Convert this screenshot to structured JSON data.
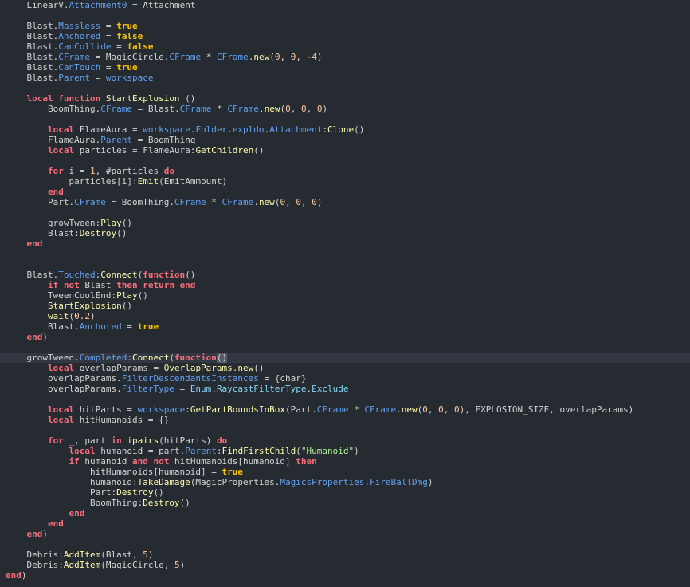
{
  "colors": {
    "background": "#262a31",
    "current_line": "#333741",
    "keyword": "#f86d7c",
    "boolean": "#ffc600",
    "property": "#61a1f1",
    "method": "#fdfbac",
    "number": "#ffc99e",
    "string": "#adf195",
    "enum": "#84d6f7",
    "identifier": "#d4d4d4"
  },
  "editor": {
    "highlighted_line": 34,
    "lines": [
      [
        [
          "    LinearV.",
          "id"
        ],
        [
          "Attachment0",
          "prop"
        ],
        [
          " = Attachment",
          "id"
        ]
      ],
      [],
      [
        [
          "    Blast.",
          "id"
        ],
        [
          "Massless",
          "prop"
        ],
        [
          " = ",
          "id"
        ],
        [
          "true",
          "bool"
        ]
      ],
      [
        [
          "    Blast.",
          "id"
        ],
        [
          "Anchored",
          "prop"
        ],
        [
          " = ",
          "id"
        ],
        [
          "false",
          "bool"
        ]
      ],
      [
        [
          "    Blast.",
          "id"
        ],
        [
          "CanCollide",
          "prop"
        ],
        [
          " = ",
          "id"
        ],
        [
          "false",
          "bool"
        ]
      ],
      [
        [
          "    Blast.",
          "id"
        ],
        [
          "CFrame",
          "prop"
        ],
        [
          " = MagicCircle.",
          "id"
        ],
        [
          "CFrame",
          "prop"
        ],
        [
          " * ",
          "id"
        ],
        [
          "CFrame",
          "prop"
        ],
        [
          ".",
          "id"
        ],
        [
          "new",
          "call"
        ],
        [
          "(",
          "id"
        ],
        [
          "0",
          "num"
        ],
        [
          ", ",
          "id"
        ],
        [
          "0",
          "num"
        ],
        [
          ", -",
          "id"
        ],
        [
          "4",
          "num"
        ],
        [
          ")",
          "id"
        ]
      ],
      [
        [
          "    Blast.",
          "id"
        ],
        [
          "CanTouch",
          "prop"
        ],
        [
          " = ",
          "id"
        ],
        [
          "true",
          "bool"
        ]
      ],
      [
        [
          "    Blast.",
          "id"
        ],
        [
          "Parent",
          "prop"
        ],
        [
          " = ",
          "id"
        ],
        [
          "workspace",
          "prop"
        ]
      ],
      [],
      [
        [
          "    ",
          "id"
        ],
        [
          "local function",
          "kw"
        ],
        [
          " ",
          "id"
        ],
        [
          "StartExplosion",
          "call"
        ],
        [
          " ()",
          "id"
        ]
      ],
      [
        [
          "        BoomThing.",
          "id"
        ],
        [
          "CFrame",
          "prop"
        ],
        [
          " = Blast.",
          "id"
        ],
        [
          "CFrame",
          "prop"
        ],
        [
          " * ",
          "id"
        ],
        [
          "CFrame",
          "prop"
        ],
        [
          ".",
          "id"
        ],
        [
          "new",
          "call"
        ],
        [
          "(",
          "id"
        ],
        [
          "0",
          "num"
        ],
        [
          ", ",
          "id"
        ],
        [
          "0",
          "num"
        ],
        [
          ", ",
          "id"
        ],
        [
          "0",
          "num"
        ],
        [
          ")",
          "id"
        ]
      ],
      [],
      [
        [
          "        ",
          "id"
        ],
        [
          "local",
          "kw"
        ],
        [
          " FlameAura = ",
          "id"
        ],
        [
          "workspace",
          "prop"
        ],
        [
          ".",
          "id"
        ],
        [
          "Folder",
          "prop"
        ],
        [
          ".",
          "id"
        ],
        [
          "expldo",
          "prop"
        ],
        [
          ".",
          "id"
        ],
        [
          "Attachment",
          "prop"
        ],
        [
          ":",
          "id"
        ],
        [
          "Clone",
          "call"
        ],
        [
          "()",
          "id"
        ]
      ],
      [
        [
          "        FlameAura.",
          "id"
        ],
        [
          "Parent",
          "prop"
        ],
        [
          " = BoomThing",
          "id"
        ]
      ],
      [
        [
          "        ",
          "id"
        ],
        [
          "local",
          "kw"
        ],
        [
          " particles = FlameAura:",
          "id"
        ],
        [
          "GetChildren",
          "call"
        ],
        [
          "()",
          "id"
        ]
      ],
      [],
      [
        [
          "        ",
          "id"
        ],
        [
          "for",
          "kw"
        ],
        [
          " i = ",
          "id"
        ],
        [
          "1",
          "num"
        ],
        [
          ", #particles ",
          "id"
        ],
        [
          "do",
          "kw"
        ]
      ],
      [
        [
          "            particles[i]:",
          "id"
        ],
        [
          "Emit",
          "call"
        ],
        [
          "(EmitAmmount)",
          "id"
        ]
      ],
      [
        [
          "        ",
          "id"
        ],
        [
          "end",
          "kw"
        ]
      ],
      [
        [
          "        Part.",
          "id"
        ],
        [
          "CFrame",
          "prop"
        ],
        [
          " = BoomThing.",
          "id"
        ],
        [
          "CFrame",
          "prop"
        ],
        [
          " * ",
          "id"
        ],
        [
          "CFrame",
          "prop"
        ],
        [
          ".",
          "id"
        ],
        [
          "new",
          "call"
        ],
        [
          "(",
          "id"
        ],
        [
          "0",
          "num"
        ],
        [
          ", ",
          "id"
        ],
        [
          "0",
          "num"
        ],
        [
          ", ",
          "id"
        ],
        [
          "0",
          "num"
        ],
        [
          ")",
          "id"
        ]
      ],
      [],
      [
        [
          "        growTween:",
          "id"
        ],
        [
          "Play",
          "call"
        ],
        [
          "()",
          "id"
        ]
      ],
      [
        [
          "        Blast:",
          "id"
        ],
        [
          "Destroy",
          "call"
        ],
        [
          "()",
          "id"
        ]
      ],
      [
        [
          "    ",
          "id"
        ],
        [
          "end",
          "kw"
        ]
      ],
      [],
      [],
      [
        [
          "    Blast.",
          "id"
        ],
        [
          "Touched",
          "prop"
        ],
        [
          ":",
          "id"
        ],
        [
          "Connect",
          "call"
        ],
        [
          "(",
          "id"
        ],
        [
          "function",
          "kw"
        ],
        [
          "()",
          "id"
        ]
      ],
      [
        [
          "        ",
          "id"
        ],
        [
          "if not",
          "kw"
        ],
        [
          " Blast ",
          "id"
        ],
        [
          "then return end",
          "kw"
        ]
      ],
      [
        [
          "        TweenCoolEnd:",
          "id"
        ],
        [
          "Play",
          "call"
        ],
        [
          "()",
          "id"
        ]
      ],
      [
        [
          "        ",
          "id"
        ],
        [
          "StartExplosion",
          "call"
        ],
        [
          "()",
          "id"
        ]
      ],
      [
        [
          "        ",
          "id"
        ],
        [
          "wait",
          "call"
        ],
        [
          "(",
          "id"
        ],
        [
          "0.2",
          "num"
        ],
        [
          ")",
          "id"
        ]
      ],
      [
        [
          "        Blast.",
          "id"
        ],
        [
          "Anchored",
          "prop"
        ],
        [
          " = ",
          "id"
        ],
        [
          "true",
          "bool"
        ]
      ],
      [
        [
          "    ",
          "id"
        ],
        [
          "end",
          "kw"
        ],
        [
          ")",
          "id"
        ]
      ],
      [],
      [
        [
          "    growTween.",
          "id"
        ],
        [
          "Completed",
          "prop"
        ],
        [
          ":",
          "id"
        ],
        [
          "Connect",
          "call"
        ],
        [
          "(",
          "id"
        ],
        [
          "function",
          "kw"
        ],
        [
          "(",
          "paren-match"
        ],
        [
          ")",
          "paren-match"
        ]
      ],
      [
        [
          "        ",
          "id"
        ],
        [
          "local",
          "kw"
        ],
        [
          " overlapParams = ",
          "id"
        ],
        [
          "OverlapParams",
          "call"
        ],
        [
          ".",
          "id"
        ],
        [
          "new",
          "call"
        ],
        [
          "()",
          "id"
        ]
      ],
      [
        [
          "        overlapParams.",
          "id"
        ],
        [
          "FilterDescendantsInstances",
          "prop"
        ],
        [
          " = {char}",
          "id"
        ]
      ],
      [
        [
          "        overlapParams.",
          "id"
        ],
        [
          "FilterType",
          "prop"
        ],
        [
          " = ",
          "id"
        ],
        [
          "Enum",
          "enum"
        ],
        [
          ".",
          "id"
        ],
        [
          "RaycastFilterType",
          "enum"
        ],
        [
          ".",
          "id"
        ],
        [
          "Exclude",
          "enum"
        ]
      ],
      [],
      [
        [
          "        ",
          "id"
        ],
        [
          "local",
          "kw"
        ],
        [
          " hitParts = ",
          "id"
        ],
        [
          "workspace",
          "prop"
        ],
        [
          ":",
          "id"
        ],
        [
          "GetPartBoundsInBox",
          "call"
        ],
        [
          "(Part.",
          "id"
        ],
        [
          "CFrame",
          "prop"
        ],
        [
          " * ",
          "id"
        ],
        [
          "CFrame",
          "prop"
        ],
        [
          ".",
          "id"
        ],
        [
          "new",
          "call"
        ],
        [
          "(",
          "id"
        ],
        [
          "0",
          "num"
        ],
        [
          ", ",
          "id"
        ],
        [
          "0",
          "num"
        ],
        [
          ", ",
          "id"
        ],
        [
          "0",
          "num"
        ],
        [
          "), EXPLOSION_SIZE, overlapParams)",
          "id"
        ]
      ],
      [
        [
          "        ",
          "id"
        ],
        [
          "local",
          "kw"
        ],
        [
          " hitHumanoids = {}",
          "id"
        ]
      ],
      [],
      [
        [
          "        ",
          "id"
        ],
        [
          "for",
          "kw"
        ],
        [
          " _, part ",
          "id"
        ],
        [
          "in",
          "kw"
        ],
        [
          " ",
          "id"
        ],
        [
          "ipairs",
          "call"
        ],
        [
          "(hitParts) ",
          "id"
        ],
        [
          "do",
          "kw"
        ]
      ],
      [
        [
          "            ",
          "id"
        ],
        [
          "local",
          "kw"
        ],
        [
          " humanoid = part.",
          "id"
        ],
        [
          "Parent",
          "prop"
        ],
        [
          ":",
          "id"
        ],
        [
          "FindFirstChild",
          "call"
        ],
        [
          "(",
          "id"
        ],
        [
          "\"Humanoid\"",
          "str"
        ],
        [
          ")",
          "id"
        ]
      ],
      [
        [
          "            ",
          "id"
        ],
        [
          "if",
          "kw"
        ],
        [
          " humanoid ",
          "id"
        ],
        [
          "and not",
          "kw"
        ],
        [
          " hitHumanoids[humanoid] ",
          "id"
        ],
        [
          "then",
          "kw"
        ]
      ],
      [
        [
          "                hitHumanoids[humanoid] = ",
          "id"
        ],
        [
          "true",
          "bool"
        ]
      ],
      [
        [
          "                humanoid:",
          "id"
        ],
        [
          "TakeDamage",
          "call"
        ],
        [
          "(MagicProperties.",
          "id"
        ],
        [
          "MagicsProperties",
          "prop"
        ],
        [
          ".",
          "id"
        ],
        [
          "FireBallDmg",
          "prop"
        ],
        [
          ")",
          "id"
        ]
      ],
      [
        [
          "                Part:",
          "id"
        ],
        [
          "Destroy",
          "call"
        ],
        [
          "()",
          "id"
        ]
      ],
      [
        [
          "                BoomThing:",
          "id"
        ],
        [
          "Destroy",
          "call"
        ],
        [
          "()",
          "id"
        ]
      ],
      [
        [
          "            ",
          "id"
        ],
        [
          "end",
          "kw"
        ]
      ],
      [
        [
          "        ",
          "id"
        ],
        [
          "end",
          "kw"
        ]
      ],
      [
        [
          "    ",
          "id"
        ],
        [
          "end",
          "kw"
        ],
        [
          ")",
          "id"
        ]
      ],
      [],
      [
        [
          "    Debris:",
          "id"
        ],
        [
          "AddItem",
          "call"
        ],
        [
          "(Blast, ",
          "id"
        ],
        [
          "5",
          "num"
        ],
        [
          ")",
          "id"
        ]
      ],
      [
        [
          "    Debris:",
          "id"
        ],
        [
          "AddItem",
          "call"
        ],
        [
          "(MagicCircle, ",
          "id"
        ],
        [
          "5",
          "num"
        ],
        [
          ")",
          "id"
        ]
      ],
      [
        [
          "end",
          "kw"
        ],
        [
          ")",
          "id"
        ]
      ]
    ]
  }
}
